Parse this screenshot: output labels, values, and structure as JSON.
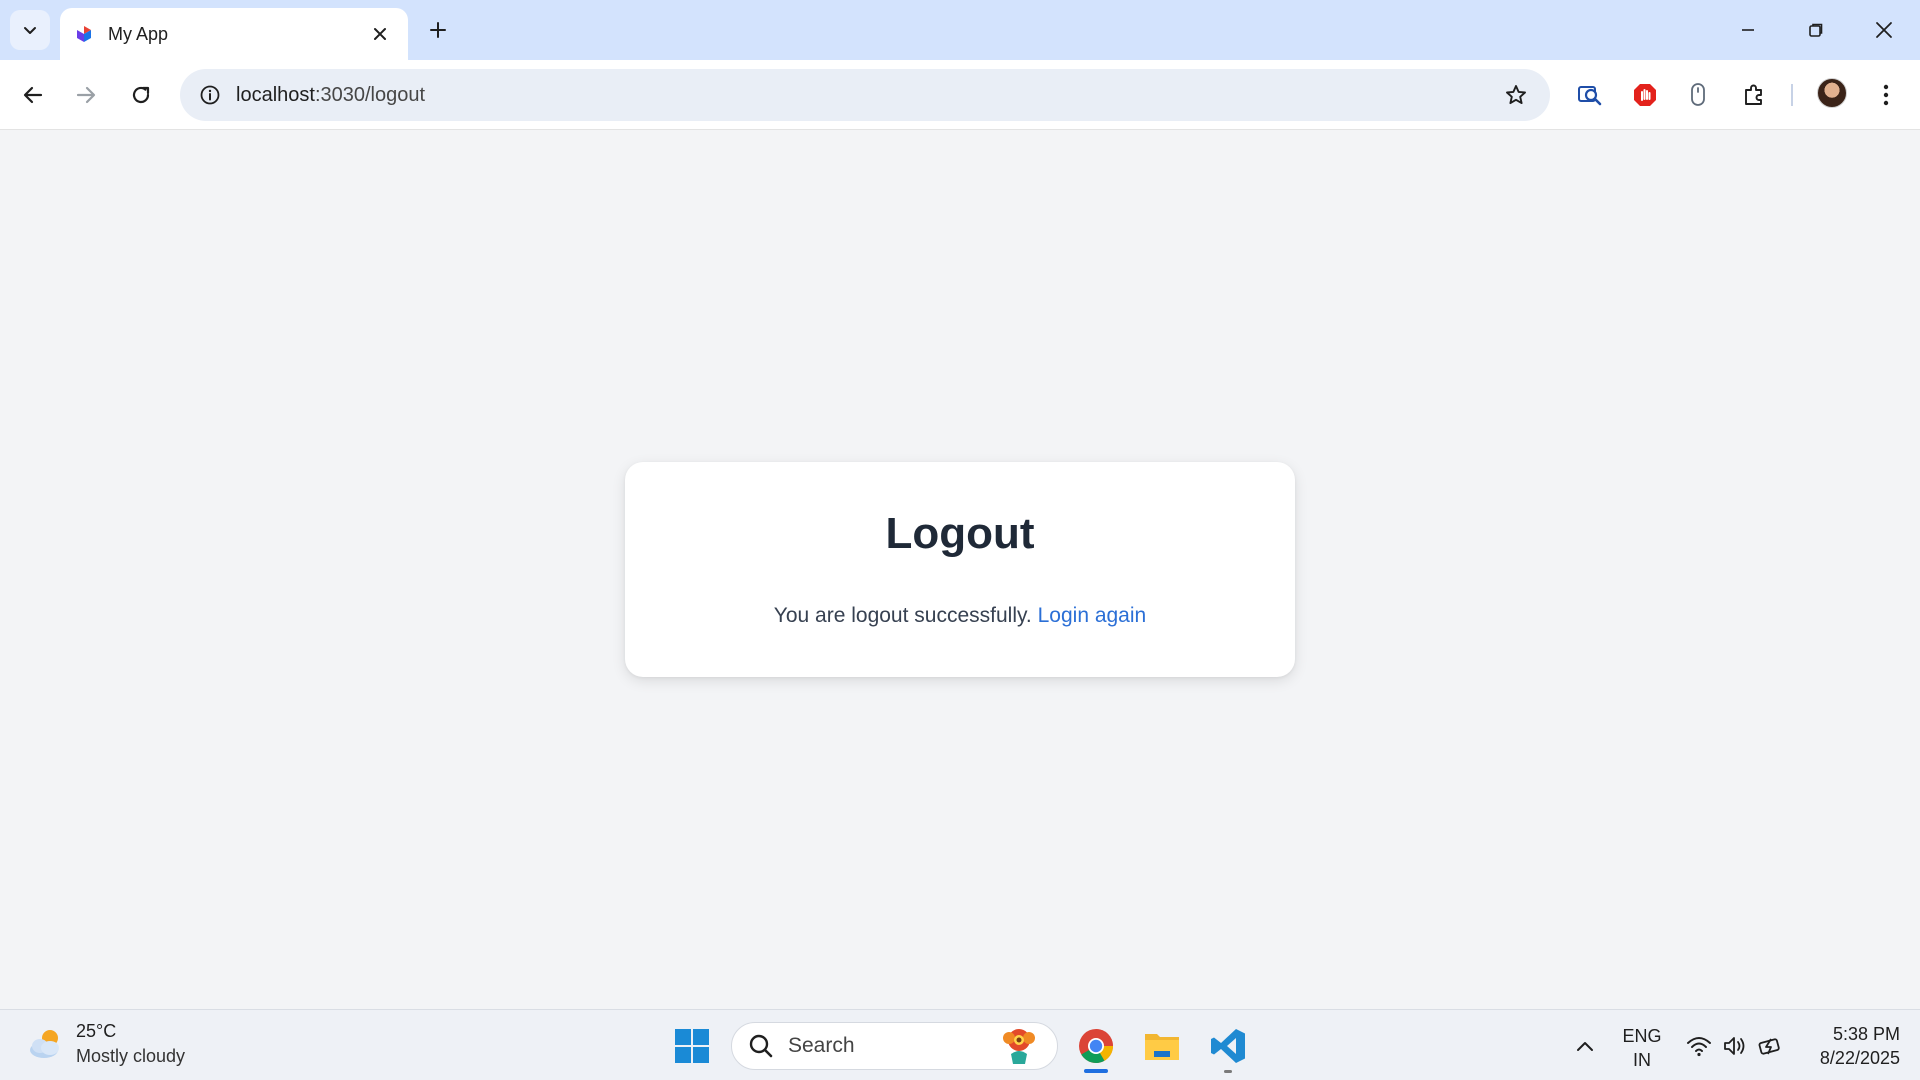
{
  "browser": {
    "tab": {
      "title": "My App"
    },
    "address_bar": {
      "host": "localhost",
      "path": ":3030/logout"
    }
  },
  "page": {
    "heading": "Logout",
    "message": "You are logout successfully.",
    "link_label": "Login again"
  },
  "taskbar": {
    "weather": {
      "temperature": "25°C",
      "condition": "Mostly cloudy"
    },
    "search_placeholder": "Search",
    "language": {
      "line1": "ENG",
      "line2": "IN"
    },
    "clock": {
      "time": "5:38 PM",
      "date": "8/22/2025"
    }
  },
  "colors": {
    "tabstrip_bg": "#d3e3fd",
    "page_bg": "#f3f4f6",
    "link": "#2b6fd6",
    "heading": "#1f2937"
  }
}
